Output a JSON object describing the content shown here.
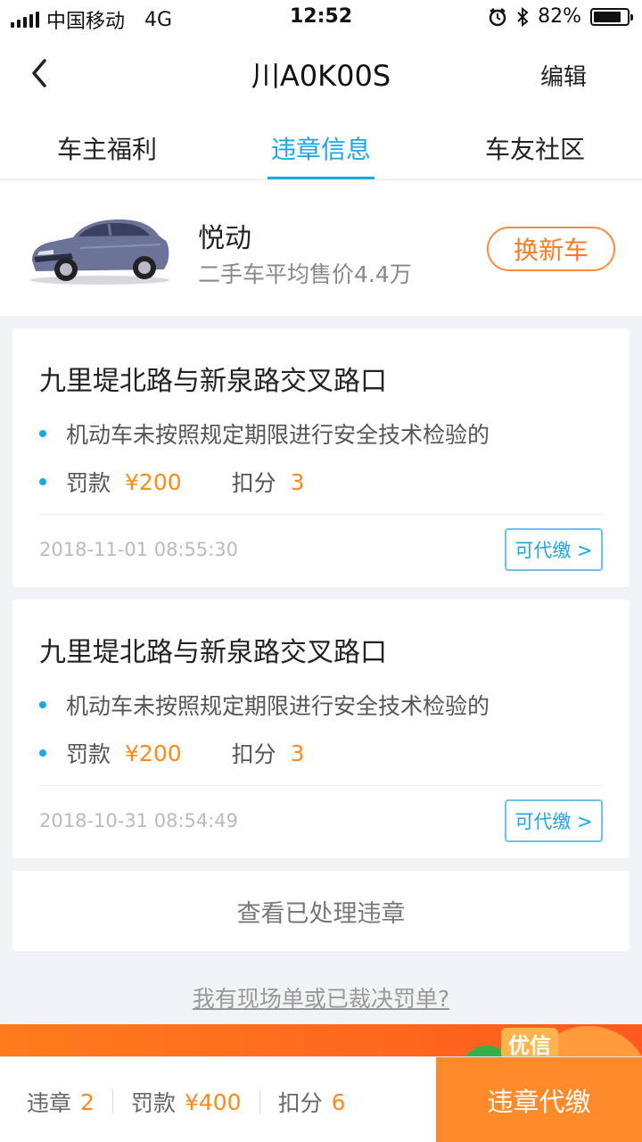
{
  "status_bar": {
    "carrier": "中国移动",
    "network": "4G",
    "time": "12:52",
    "battery": "82%",
    "battery_level": 0.82
  },
  "nav": {
    "title": "川A0K00S",
    "edit_label": "编辑"
  },
  "tabs": [
    {
      "label": "车主福利",
      "active": false
    },
    {
      "label": "违章信息",
      "active": true
    },
    {
      "label": "车友社区",
      "active": false
    }
  ],
  "car": {
    "name": "悦动",
    "price_text": "二手车平均售价4.4万",
    "renew_label": "换新车"
  },
  "violations": [
    {
      "location": "九里堤北路与新泉路交叉路口",
      "description": "机动车未按照规定期限进行安全技术检验的",
      "fine_label": "罚款",
      "fine": "¥200",
      "points_label": "扣分",
      "points": "3",
      "time": "2018-11-01 08:55:30",
      "pay_label": "可代缴 >"
    },
    {
      "location": "九里堤北路与新泉路交叉路口",
      "description": "机动车未按照规定期限进行安全技术检验的",
      "fine_label": "罚款",
      "fine": "¥200",
      "points_label": "扣分",
      "points": "3",
      "time": "2018-10-31 08:54:49",
      "pay_label": "可代缴 >"
    }
  ],
  "view_handled_label": "查看已处理违章",
  "onsite_link": "我有现场单或已裁决罚单?",
  "promo": {
    "tag": "优信"
  },
  "bottom": {
    "violations_label": "违章",
    "violations_count": "2",
    "fine_label": "罚款",
    "fine_total": "¥400",
    "points_label": "扣分",
    "points_total": "6",
    "pay_all_label": "违章代缴"
  },
  "colors": {
    "accent_blue": "#1aa7e2",
    "accent_orange": "#ff8a1a",
    "pay_button_bg": "#ff8a2a"
  }
}
